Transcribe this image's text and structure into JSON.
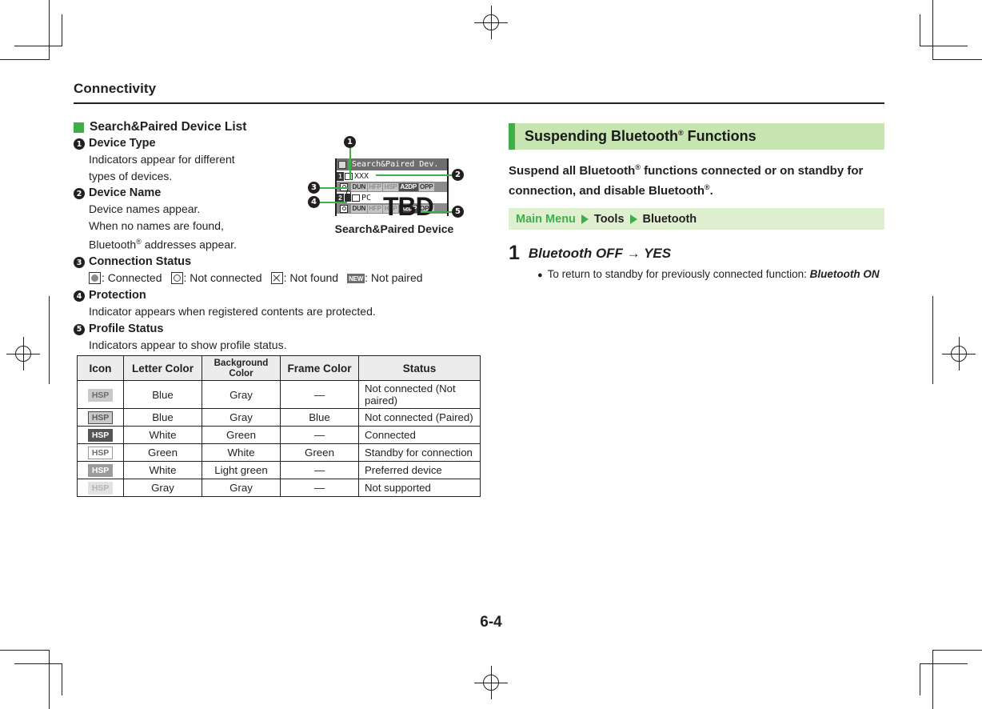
{
  "page": {
    "running_head": "Connectivity",
    "folio": "6-4"
  },
  "left": {
    "section_heading": "Search&Paired Device List",
    "items": [
      {
        "num": "❶",
        "title": "Device Type",
        "lines": [
          "Indicators appear for different",
          "types of devices."
        ]
      },
      {
        "num": "❷",
        "title": "Device Name",
        "lines": [
          "Device names appear.",
          "When no names are found,",
          "Bluetooth® addresses appear."
        ]
      },
      {
        "num": "❸",
        "title": "Connection Status",
        "lines": []
      },
      {
        "num": "❹",
        "title": "Protection",
        "lines": [
          "Indicator appears when registered contents are protected."
        ]
      },
      {
        "num": "❺",
        "title": "Profile Status",
        "lines": [
          "Indicators appear to show profile status."
        ]
      }
    ],
    "status_legend": [
      {
        "icon": "filled-circle-icon",
        "label": ": Connected"
      },
      {
        "icon": "open-circle-icon",
        "label": ": Not connected"
      },
      {
        "icon": "cross-box-icon",
        "label": ": Not found"
      },
      {
        "icon": "new-badge-icon",
        "label": ": Not paired",
        "badge_text": "NEW"
      }
    ]
  },
  "table": {
    "headers": [
      "Icon",
      "Letter Color",
      "Background Color",
      "Frame Color",
      "Status"
    ],
    "rows": [
      {
        "icon": "HSP",
        "icon_style": "hsp-1",
        "letter": "Blue",
        "background": "Gray",
        "frame": "—",
        "status": "Not connected (Not paired)"
      },
      {
        "icon": "HSP",
        "icon_style": "hsp-2",
        "letter": "Blue",
        "background": "Gray",
        "frame": "Blue",
        "status": "Not connected (Paired)"
      },
      {
        "icon": "HSP",
        "icon_style": "hsp-3",
        "letter": "White",
        "background": "Green",
        "frame": "—",
        "status": "Connected"
      },
      {
        "icon": "HSP",
        "icon_style": "hsp-4",
        "letter": "Green",
        "background": "White",
        "frame": "Green",
        "status": "Standby for connection"
      },
      {
        "icon": "HSP",
        "icon_style": "hsp-5",
        "letter": "White",
        "background": "Light green",
        "frame": "—",
        "status": "Preferred device"
      },
      {
        "icon": "HSP",
        "icon_style": "hsp-6",
        "letter": "Gray",
        "background": "Gray",
        "frame": "—",
        "status": "Not supported"
      }
    ]
  },
  "figure": {
    "caption": "Search&Paired Device",
    "watermark": "TBD",
    "screen_title": "Search&Paired Dev.",
    "entries": [
      {
        "index": "1",
        "name": "XXX",
        "profiles": [
          {
            "text": "DUN",
            "state": "on"
          },
          {
            "text": "HFP",
            "state": "off"
          },
          {
            "text": "HSP",
            "state": "off"
          },
          {
            "text": "A2DP",
            "state": "sel"
          },
          {
            "text": "OPP",
            "state": "on"
          }
        ]
      },
      {
        "index": "2",
        "name": "PC",
        "profiles": [
          {
            "text": "DUN",
            "state": "on"
          },
          {
            "text": "HFP",
            "state": "off"
          },
          {
            "text": "HSP",
            "state": "off"
          },
          {
            "text": "A2DP",
            "state": "sel"
          },
          {
            "text": "OPP",
            "state": "on"
          }
        ]
      }
    ],
    "callouts": [
      "❶",
      "❷",
      "❸",
      "❹",
      "❺"
    ]
  },
  "right": {
    "title_prefix": "Suspending Bluetooth",
    "title_sup": "®",
    "title_suffix": " Functions",
    "title_full": "Suspending Bluetooth® Functions",
    "lead_line1": "Suspend all Bluetooth® functions connected or on standby for",
    "lead_line2": "connection, and disable Bluetooth®.",
    "path": {
      "main": "Main Menu",
      "level2": "Tools",
      "level3": "Bluetooth"
    },
    "step": {
      "number": "1",
      "text": "Bluetooth OFF → YES",
      "bullet_prefix": "To return to standby for previously connected function: ",
      "bullet_bold": "Bluetooth ON"
    }
  },
  "colors": {
    "accent_green": "#3fae49",
    "band_title_bg": "#c7e5b0",
    "band_path_bg": "#dff0d0",
    "text": "#231f20",
    "table_header_bg": "#ececec"
  }
}
